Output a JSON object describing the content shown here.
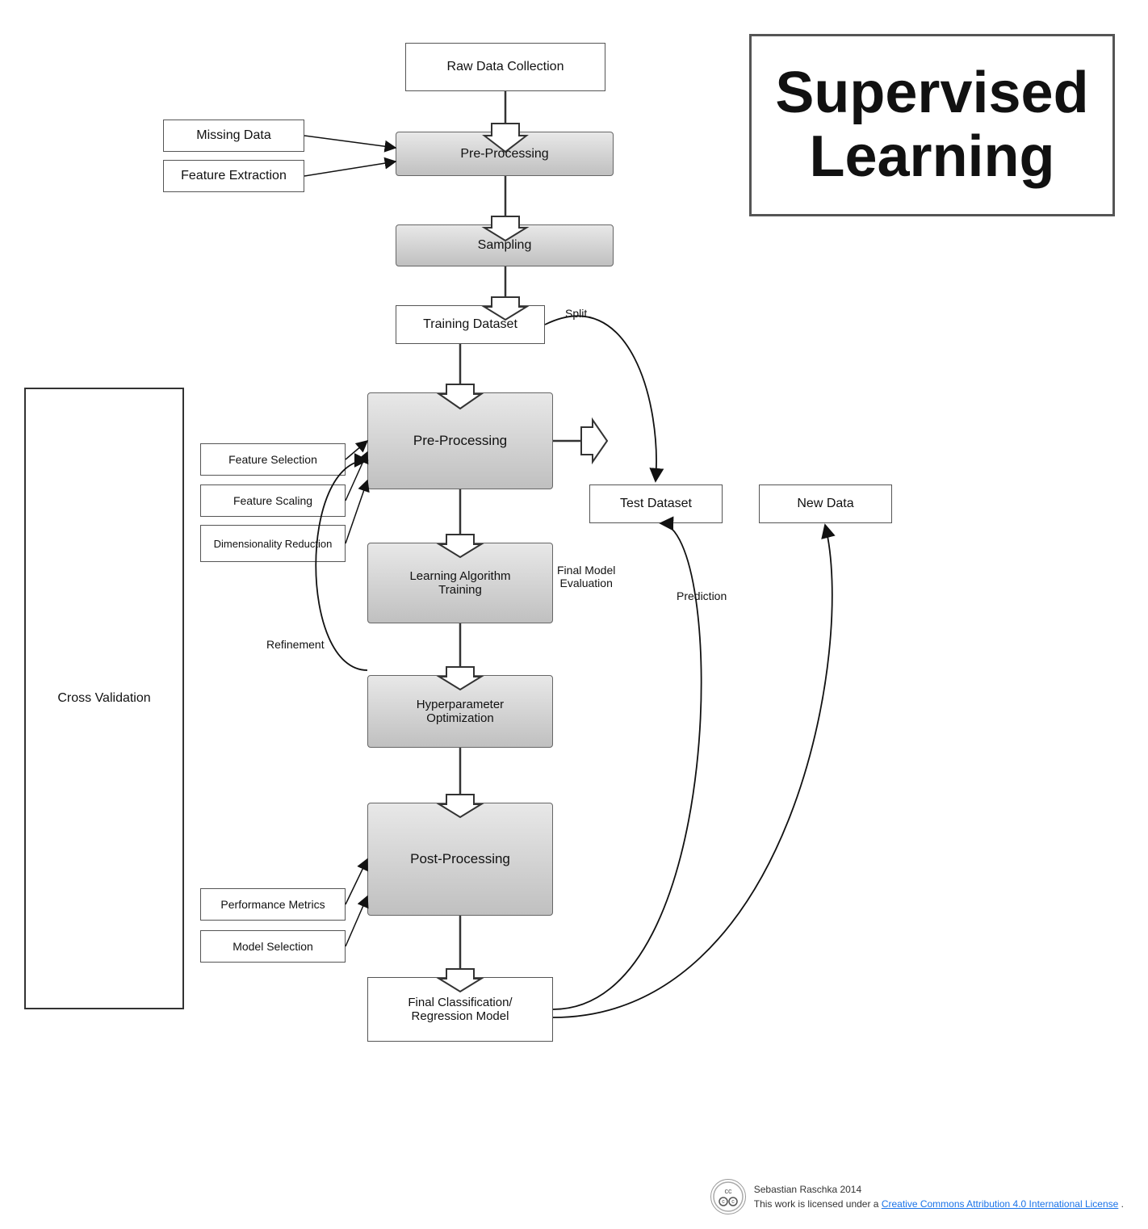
{
  "title": "Supervised Learning",
  "boxes": {
    "raw_data": "Raw Data Collection",
    "pre_processing_top": "Pre-Processing",
    "missing_data": "Missing Data",
    "feature_extraction": "Feature Extraction",
    "sampling": "Sampling",
    "training_dataset": "Training Dataset",
    "pre_processing_mid": "Pre-Processing",
    "feature_selection": "Feature Selection",
    "feature_scaling": "Feature Scaling",
    "dim_reduction": "Dimensionality Reduction",
    "learning_algo": "Learning Algorithm\nTraining",
    "hyperparameter": "Hyperparameter\nOptimization",
    "post_processing": "Post-Processing",
    "performance_metrics": "Performance Metrics",
    "model_selection": "Model Selection",
    "final_classification": "Final Classification/\nRegression Model",
    "test_dataset": "Test Dataset",
    "new_data": "New Data",
    "cross_validation": "Cross Validation"
  },
  "labels": {
    "split": "Split",
    "refinement": "Refinement",
    "final_model_eval": "Final Model\nEvaluation",
    "prediction": "Prediction"
  },
  "footer": {
    "author": "Sebastian Raschka 2014",
    "license_text": "This work is licensed under a ",
    "license_link": "Creative Commons Attribution 4.0 International License",
    "license_suffix": "."
  }
}
